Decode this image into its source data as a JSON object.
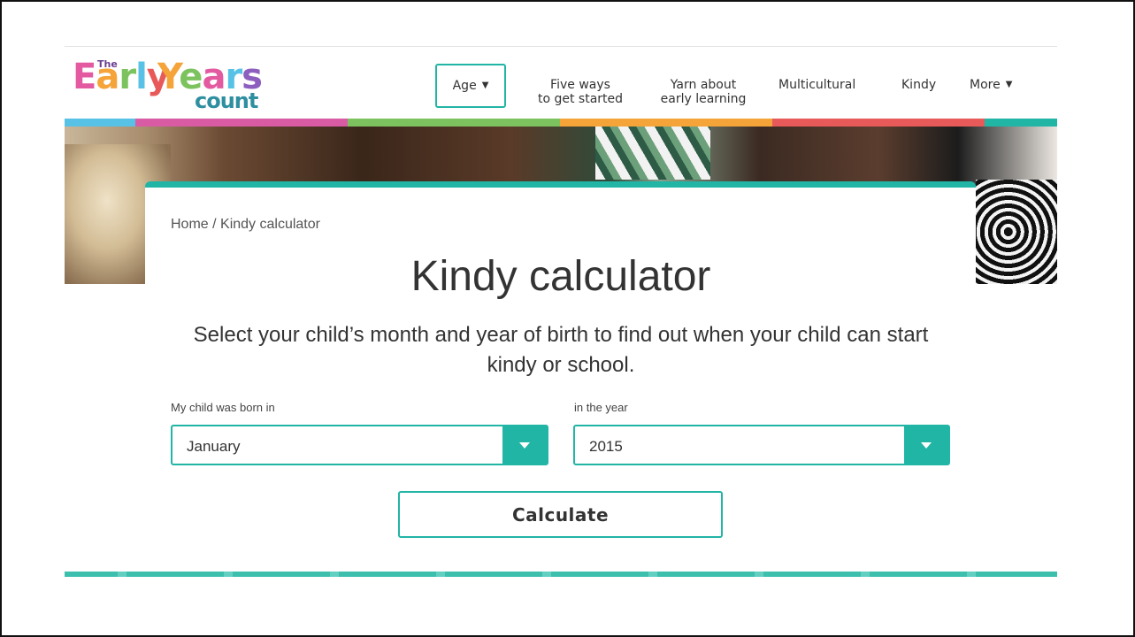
{
  "logo": {
    "the": "The",
    "word1": "Early",
    "word2": "Years",
    "word3": "count"
  },
  "nav": {
    "age": "Age",
    "five_ways_line1": "Five ways",
    "five_ways_line2": "to get started",
    "yarn_line1": "Yarn about",
    "yarn_line2": "early learning",
    "multicultural": "Multicultural",
    "kindy": "Kindy",
    "more": "More"
  },
  "colors": {
    "accent": "#21b5a5",
    "bar": [
      "#58c2e6",
      "#d95ba4",
      "#7cc35f",
      "#f5a43a",
      "#e85a5a",
      "#21b5a5"
    ]
  },
  "breadcrumb": "Home / Kindy calculator",
  "title": "Kindy calculator",
  "subtitle": "Select your child’s month and year of birth to find out when your child can start kindy or school.",
  "form": {
    "month_label": "My child was born in",
    "month_value": "January",
    "year_label": "in the year",
    "year_value": "2015",
    "submit": "Calculate"
  }
}
